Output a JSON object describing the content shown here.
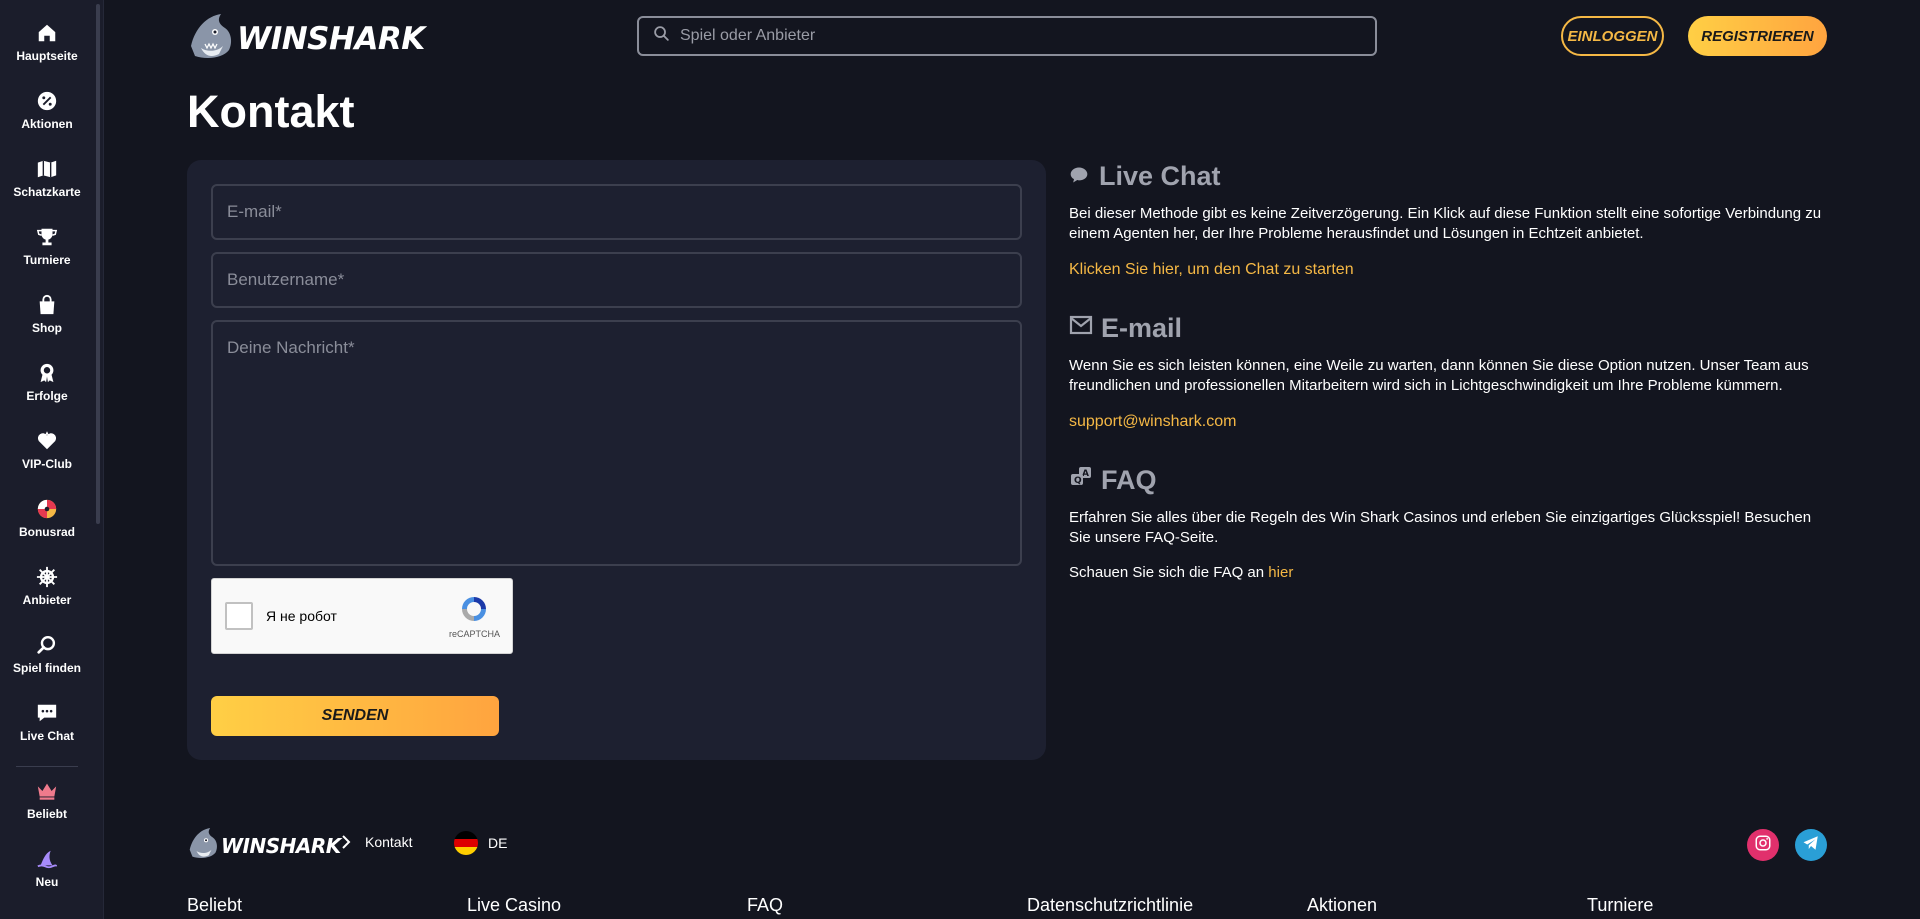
{
  "brand": {
    "name": "WINSHARK"
  },
  "sidebar": {
    "items": [
      {
        "label": "Hauptseite",
        "icon": "home-icon"
      },
      {
        "label": "Aktionen",
        "icon": "percent-icon"
      },
      {
        "label": "Schatzkarte",
        "icon": "map-icon"
      },
      {
        "label": "Turniere",
        "icon": "trophy-icon"
      },
      {
        "label": "Shop",
        "icon": "shop-bag-icon"
      },
      {
        "label": "Erfolge",
        "icon": "badge-icon"
      },
      {
        "label": "VIP-Club",
        "icon": "vip-heart-icon"
      },
      {
        "label": "Bonusrad",
        "icon": "wheel-icon"
      },
      {
        "label": "Anbieter",
        "icon": "ship-wheel-icon"
      },
      {
        "label": "Spiel finden",
        "icon": "search-icon"
      },
      {
        "label": "Live Chat",
        "icon": "chat-icon"
      },
      {
        "label": "Beliebt",
        "icon": "crown-icon"
      },
      {
        "label": "Neu",
        "icon": "shark-fin-icon"
      }
    ]
  },
  "header": {
    "search_placeholder": "Spiel oder Anbieter",
    "login_label": "EINLOGGEN",
    "register_label": "REGISTRIEREN"
  },
  "page": {
    "title": "Kontakt"
  },
  "form": {
    "email_placeholder": "E-mail*",
    "username_placeholder": "Benutzername*",
    "message_placeholder": "Deine Nachricht*",
    "captcha_label": "Я не робот",
    "captcha_brand": "reCAPTCHA",
    "send_label": "SENDEN"
  },
  "info": {
    "live_chat": {
      "title": "Live Chat",
      "text": "Bei dieser Methode gibt es keine Zeitverzögerung. Ein Klick auf diese Funktion stellt eine sofortige Verbindung zu einem Agenten her, der Ihre Probleme herausfindet und Lösungen in Echtzeit anbietet.",
      "link": "Klicken Sie hier, um den Chat zu starten"
    },
    "email": {
      "title": "E-mail",
      "text": "Wenn Sie es sich leisten können, eine Weile zu warten, dann können Sie diese Option nutzen. Unser Team aus freundlichen und professionellen Mitarbeitern wird sich in Lichtgeschwindigkeit um Ihre Probleme kümmern.",
      "address": "support@winshark.com"
    },
    "faq": {
      "title": "FAQ",
      "text": "Erfahren Sie alles über die Regeln des Win Shark Casinos und erleben Sie einzigartiges Glücksspiel! Besuchen Sie unsere FAQ-Seite.",
      "line_prefix": "Schauen Sie sich die FAQ an",
      "line_link": "hier"
    }
  },
  "footer": {
    "breadcrumb_current": "Kontakt",
    "language": "DE",
    "links": [
      "Beliebt",
      "Live Casino",
      "FAQ",
      "Datenschutzrichtlinie",
      "Aktionen",
      "Turniere"
    ]
  },
  "colors": {
    "accent": "#f5b845",
    "background": "#13151f",
    "sidebar": "#1b1d2b",
    "panel": "#1d2030"
  }
}
